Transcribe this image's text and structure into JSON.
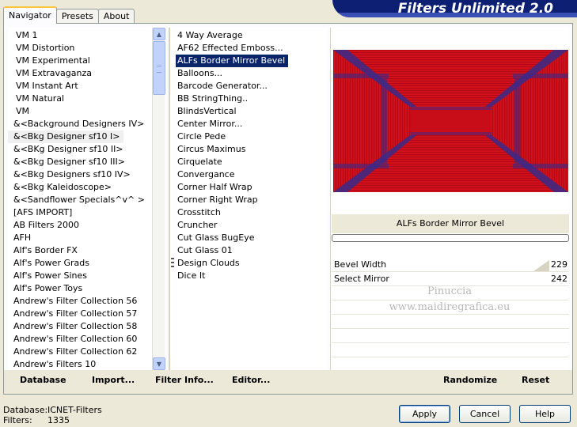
{
  "window": {
    "title": "Filters Unlimited 2.0"
  },
  "tabs": [
    {
      "label": "Navigator",
      "active": true
    },
    {
      "label": "Presets",
      "active": false
    },
    {
      "label": "About",
      "active": false
    }
  ],
  "categories": [
    "VM 1",
    "VM Distortion",
    "VM Experimental",
    "VM Extravaganza",
    "VM Instant Art",
    "VM Natural",
    "VM",
    "&<Background Designers IV>",
    "&<Bkg Designer sf10 I>",
    "&<BKg Designer sf10 II>",
    "&<Bkg Designer sf10 III>",
    "&<Bkg Designers sf10 IV>",
    "&<Bkg Kaleidoscope>",
    "&<Sandflower Specials^v^ >",
    "[AFS IMPORT]",
    "AB Filters 2000",
    "AFH",
    "Alf's Border FX",
    "Alf's Power Grads",
    "Alf's Power Sines",
    "Alf's Power Toys",
    "Andrew's Filter Collection 56",
    "Andrew's Filter Collection 57",
    "Andrew's Filter Collection 58",
    "Andrew's Filter Collection 60",
    "Andrew's Filter Collection 62",
    "Andrew's Filters 10"
  ],
  "categories_selected_index": 8,
  "filters": [
    "4 Way Average",
    "AF62 Effected Emboss...",
    "ALFs Border Mirror Bevel",
    "Balloons...",
    "Barcode Generator...",
    "BB StringThing..",
    "BlindsVertical",
    "Center Mirror...",
    "Circle Pede",
    "Circus Maximus",
    "Cirquelate",
    "Convergance",
    "Corner Half Wrap",
    "Corner Right Wrap",
    "Crosstitch",
    "Cruncher",
    "Cut Glass  BugEye",
    "Cut Glass 01",
    "Design Clouds",
    "Dice It"
  ],
  "filters_selected_index": 2,
  "preview": {
    "filter_name": "ALFs Border Mirror Bevel",
    "params": [
      {
        "label": "Bevel Width",
        "value": "229"
      },
      {
        "label": "Select Mirror",
        "value": "242"
      }
    ],
    "watermark_line1": "Pinuccia",
    "watermark_line2": "www.maidiregrafica.eu",
    "colors": {
      "primary": "#d0101a",
      "secondary": "#3a2a8a"
    }
  },
  "toolbar": {
    "database": "Database",
    "import": "Import...",
    "filter_info": "Filter Info...",
    "editor": "Editor...",
    "randomize": "Randomize",
    "reset": "Reset"
  },
  "status": {
    "database_label": "Database:",
    "database_value": "ICNET-Filters",
    "filters_label": "Filters:",
    "filters_value": "1335"
  },
  "buttons": {
    "apply": "Apply",
    "cancel": "Cancel",
    "help": "Help"
  }
}
